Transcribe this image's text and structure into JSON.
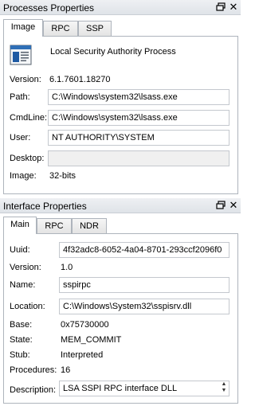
{
  "process_panel": {
    "title": "Processes Properties",
    "tabs": [
      "Image",
      "RPC",
      "SSP"
    ],
    "description": "Local Security Authority Process",
    "version_label": "Version:",
    "version_value": "6.1.7601.18270",
    "path_label": "Path:",
    "path_value": "C:\\Windows\\system32\\lsass.exe",
    "cmdline_label": "CmdLine:",
    "cmdline_value": "C:\\Windows\\system32\\lsass.exe",
    "user_label": "User:",
    "user_value": "NT AUTHORITY\\SYSTEM",
    "desktop_label": "Desktop:",
    "desktop_value": "",
    "image_label": "Image:",
    "image_value": "32-bits"
  },
  "interface_panel": {
    "title": "Interface Properties",
    "tabs": [
      "Main",
      "RPC",
      "NDR"
    ],
    "uuid_label": "Uuid:",
    "uuid_value": "4f32adc8-6052-4a04-8701-293ccf2096f0",
    "version_label": "Version:",
    "version_value": "1.0",
    "name_label": "Name:",
    "name_value": "sspirpc",
    "location_label": "Location:",
    "location_value": "C:\\Windows\\System32\\sspisrv.dll",
    "base_label": "Base:",
    "base_value": "0x75730000",
    "state_label": "State:",
    "state_value": "MEM_COMMIT",
    "stub_label": "Stub:",
    "stub_value": "Interpreted",
    "procedures_label": "Procedures:",
    "procedures_value": "16",
    "description_label": "Description:",
    "description_value": "LSA SSPI RPC interface DLL"
  },
  "icons": {
    "pin": "pin-window-icon",
    "close": "close-icon",
    "process": "process-window-icon"
  },
  "colors": {
    "titlebar": "#dfe3e8",
    "border": "#aeb4bc",
    "disabled_field": "#f0f0f0"
  }
}
